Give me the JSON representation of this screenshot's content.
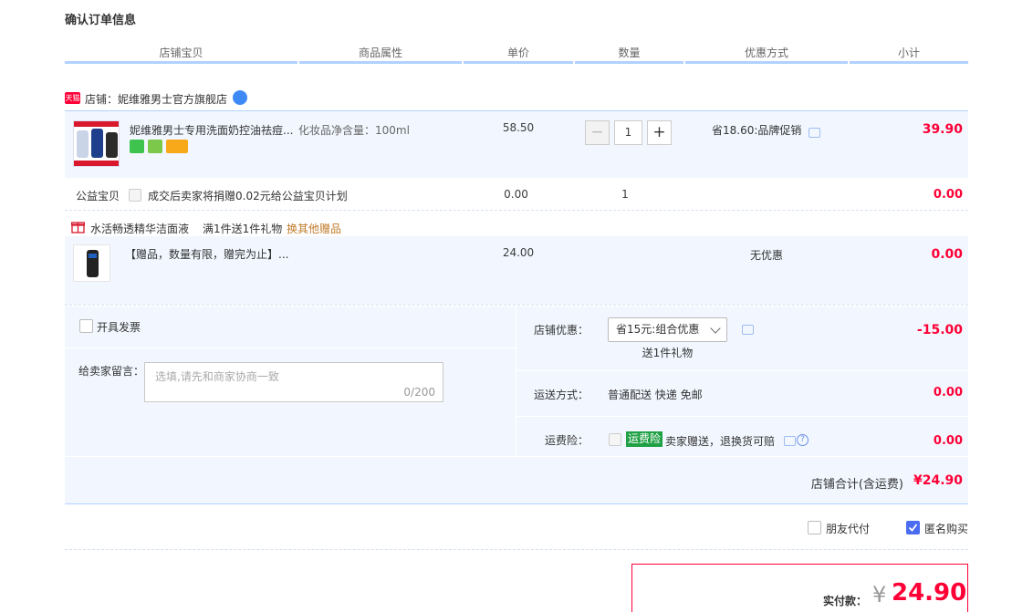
{
  "page_title": "确认订单信息",
  "columns": [
    "店铺宝贝",
    "商品属性",
    "单价",
    "数量",
    "优惠方式",
    "小计"
  ],
  "shop": {
    "badge": "天猫",
    "label": "店铺：",
    "name": "妮维雅男士官方旗舰店"
  },
  "item": {
    "name": "妮维雅男士专用洗面奶控油祛痘...",
    "attr": "化妆品净含量：100ml",
    "price": "58.50",
    "quantity": "1",
    "decrease": "−",
    "increase": "+",
    "discount": "省18.60:品牌促销",
    "subtotal": "39.90"
  },
  "charity": {
    "label": "公益宝贝",
    "desc": "成交后卖家将捐赠0.02元给公益宝贝计划",
    "price": "0.00",
    "quantity": "1",
    "subtotal": "0.00"
  },
  "gift": {
    "name": "水活畅透精华洁面液",
    "rule": "满1件送1件礼物",
    "change": "换其他赠品",
    "item_name": "【赠品，数量有限，赠完为止】...",
    "price": "24.00",
    "discount": "无优惠",
    "subtotal": "0.00"
  },
  "invoice": {
    "label": "开具发票"
  },
  "message": {
    "label": "给卖家留言：",
    "placeholder": "选填,请先和商家协商一致",
    "counter": "0/200"
  },
  "shop_discount": {
    "label": "店铺优惠：",
    "select": "省15元:组合优惠",
    "gift_note": "送1件礼物",
    "value": "-15.00"
  },
  "shipping": {
    "label": "运送方式：",
    "desc": "普通配送 快递 免邮",
    "value": "0.00"
  },
  "insurance": {
    "label": "运费险：",
    "tag": "运费险",
    "desc": "卖家赠送，退换货可赔",
    "value": "0.00"
  },
  "shop_total": {
    "label": "店铺合计(含运费)",
    "value": "¥24.90"
  },
  "options": {
    "friend_pay": "朋友代付",
    "anonymous": "匿名购买"
  },
  "payment": {
    "label": "实付款：",
    "currency": "¥",
    "value": "24.90"
  },
  "colors": {
    "accent_red": "#ff0036",
    "header_line": "#b2d1ff",
    "row_bg": "#f2f7ff",
    "check_blue": "#4b6cf0",
    "insurance_green": "#1fa045"
  }
}
